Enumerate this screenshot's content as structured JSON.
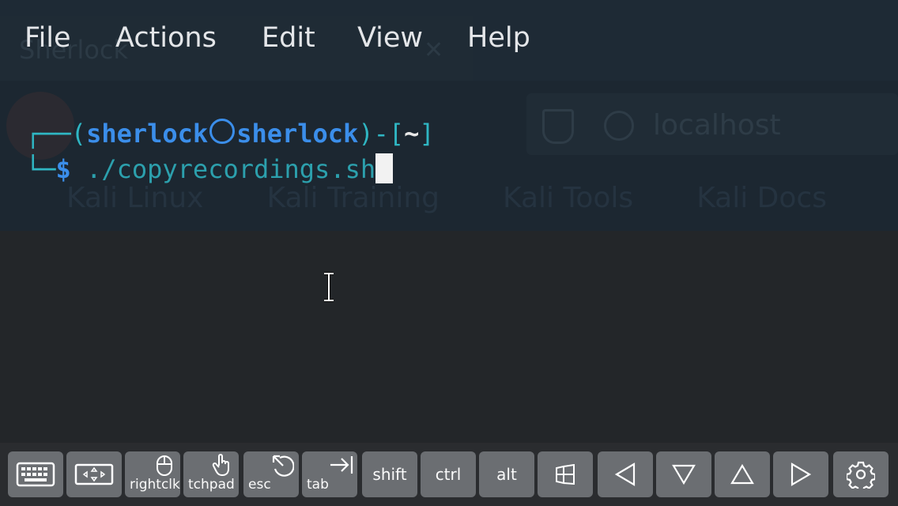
{
  "menu": {
    "items": [
      "File",
      "Actions",
      "Edit",
      "View",
      "Help"
    ]
  },
  "background_window": {
    "tab_title": "Sherlock",
    "url": "localhost",
    "bookmarks": [
      "Kali Linux",
      "Kali Training",
      "Kali Tools",
      "Kali Docs"
    ]
  },
  "terminal": {
    "prompt_open": "┌──(",
    "user": "sherlock",
    "host": "sherlock",
    "prompt_mid": ")-[",
    "cwd": "~",
    "prompt_close": "]",
    "line2_prefix": "└─",
    "dollar": "$",
    "command": " ./copyrecordings.sh"
  },
  "keyboard": {
    "keys": [
      {
        "name": "keyboard-toggle",
        "label": "",
        "icon": "keyboard-icon"
      },
      {
        "name": "arrows-toggle",
        "label": "",
        "icon": "arrow-pad-icon"
      },
      {
        "name": "rightclick",
        "label": "rightclk",
        "icon": "mouse-icon"
      },
      {
        "name": "touchpad",
        "label": "tchpad",
        "icon": "hand-pointer-icon"
      },
      {
        "name": "escape",
        "label": "esc",
        "icon": "escape-arrow-icon"
      },
      {
        "name": "tab",
        "label": "tab",
        "icon": "tab-arrow-icon"
      },
      {
        "name": "shift",
        "label": "shift"
      },
      {
        "name": "ctrl",
        "label": "ctrl"
      },
      {
        "name": "alt",
        "label": "alt"
      },
      {
        "name": "windows",
        "label": "",
        "icon": "windows-icon"
      },
      {
        "name": "left",
        "label": "",
        "icon": "triangle-left-icon"
      },
      {
        "name": "down",
        "label": "",
        "icon": "triangle-down-icon"
      },
      {
        "name": "up",
        "label": "",
        "icon": "triangle-up-icon"
      },
      {
        "name": "right",
        "label": "",
        "icon": "triangle-right-icon"
      },
      {
        "name": "settings",
        "label": "",
        "icon": "gear-icon"
      }
    ]
  },
  "colors": {
    "background": "#232629",
    "prompt_cyan": "#2fb6c3",
    "prompt_blue": "#3b8eea",
    "key_bg": "#6b6e72"
  }
}
